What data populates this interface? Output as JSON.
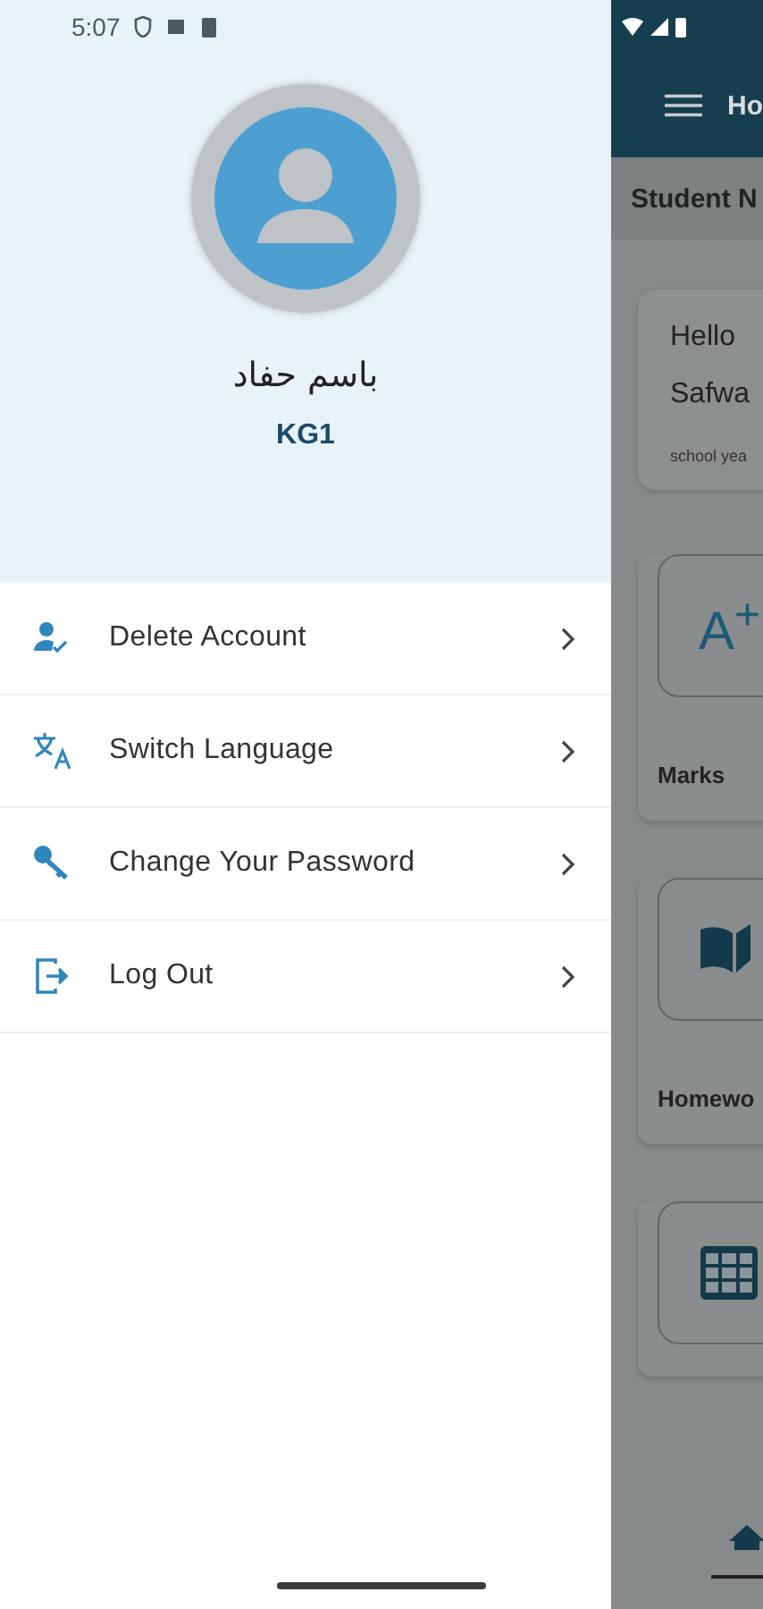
{
  "status_bar": {
    "time": "5:07"
  },
  "drawer": {
    "profile": {
      "name": "باسم حفاد",
      "class": "KG1"
    },
    "items": [
      {
        "kind": "account",
        "label": "Delete Account"
      },
      {
        "kind": "language",
        "label": "Switch Language"
      },
      {
        "kind": "password",
        "label": "Change Your Password"
      },
      {
        "kind": "logout",
        "label": "Log Out"
      }
    ]
  },
  "background_page": {
    "app_bar_title": "Ho",
    "header": "Student N",
    "greeting": {
      "hello": "Hello",
      "name": "Safwa",
      "subtitle": "school yea"
    },
    "tiles": [
      {
        "kind": "marks",
        "icon_text": "A$^{+}$",
        "label": "Marks"
      },
      {
        "kind": "homework",
        "label": "Homewo"
      },
      {
        "kind": "timetable"
      }
    ]
  }
}
